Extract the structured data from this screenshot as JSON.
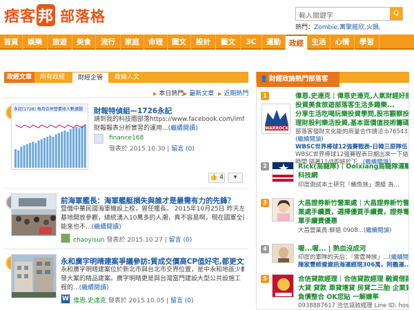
{
  "header": {
    "logo_part1": "痞客",
    "logo_badge": "邦",
    "logo_part2": "部落格",
    "search_placeholder": "輸入關鍵字",
    "search_button": "Q",
    "hot_label": "熱門：",
    "hot_keywords": "Zombie,寓聚館欣,火鍋,"
  },
  "nav": [
    {
      "label": "首頁",
      "active": false
    },
    {
      "label": "娛樂",
      "active": false
    },
    {
      "label": "旅遊",
      "active": false
    },
    {
      "label": "美食",
      "active": false
    },
    {
      "label": "流行",
      "active": false
    },
    {
      "label": "家庭",
      "active": false
    },
    {
      "label": "命理",
      "active": false
    },
    {
      "label": "圖文",
      "active": false
    },
    {
      "label": "設計",
      "active": false
    },
    {
      "label": "藝文",
      "active": false
    },
    {
      "label": "3C",
      "active": false
    },
    {
      "label": "運動",
      "active": false
    },
    {
      "label": "政經",
      "active": true
    },
    {
      "label": "生活",
      "active": false
    },
    {
      "label": "心情",
      "active": false
    },
    {
      "label": "學習",
      "active": false
    }
  ],
  "left": {
    "tabs": [
      "政經文章",
      "所有政經",
      "財經企管",
      "政論人文"
    ],
    "sort": {
      "today": "本日熱門",
      "latest": "最新文章",
      "recent": "近期熱門"
    }
  },
  "entries": [
    {
      "rank": "1",
      "title": "財報特偵組—1726永記",
      "desc1": "請到我的科技圈部落https://www.facebook.com/imfinance168 IFRS",
      "desc2": "財報報表分析實習的運用...",
      "more": "(繼續閱讀)",
      "author": "finance168",
      "posted_label": "發表於",
      "date": "2015.10.30",
      "comments": "留言 (0)",
      "likes": "4",
      "thumb_title": "永記(1726)  每月合併營業收入數據圖"
    },
    {
      "rank": "2",
      "title": "前海軍艦長：海軍艦艇損失與誰才是最需有力的先鋒？",
      "desc1": "暨僑中華民國海軍機設上校，曾任艦長。 2015年10月25日 昨天左營海軍",
      "desc2": "基地開放參觀，總統湧入10萬多的人潮，真不容易啊，現在國軍全部加",
      "desc3": "能來也不...",
      "more": "(繼續閱讀)",
      "author": "chaoyisun",
      "posted_label": "發表於",
      "date": "2015.10.27",
      "comments": "留言 (0)"
    },
    {
      "rank": "3",
      "title": "永和廣字明晴建案爭議參訪:質成交價高CP值好宅,都更文創結活園區...",
      "desc1": "永和廣字明晴建案位於新北市與台北市交界位置，是中永和地區少數新開",
      "desc2": "發大案的精品建案。廣字明晴更是與台灣當門建設大型公共設施工",
      "desc3": "程的...",
      "more": "(繼續閱讀)",
      "author": "偉恩.史達克",
      "posted_label": "發表於",
      "date": "2015.10.05",
      "comments": "留言 (0)"
    }
  ],
  "right": {
    "header": "財經政論熱門部落客",
    "items": [
      {
        "rank": "1",
        "title1": "偉恩.史達克｜偉恩史達克,人氣財經好部落",
        "title2": "投資美食旅遊部落客生活多趣樂...",
        "title3": "分享生活吃喝玩樂投資學問,股市觀察投資",
        "title4": "理財股利樂活投資,基本面價值技術籌碼分析",
        "sub1": "部落客發財文化能的商量合作請洽:b765431...",
        "sub_more": "(繼續閱讀)",
        "sub2": "WBSC世界棒球12強賽戰表-日韓三原隊伍",
        "sub3": "WBSC世界棒球12強賽程表日期出來一下結",
        "sub4": "時間 隨著11/8即將於下...",
        "sub4_more": "(繼續閱讀)"
      },
      {
        "rank": "2",
        "title1": "Rick(烏龍隊)｜Oolxiang烏龍隊運動科技",
        "title2": "科技網",
        "sub1": "印度測試本土研究「鮪魚族」潛艇 為...",
        "sub_more": ""
      },
      {
        "rank": "3",
        "title1": "大昌證券新竹營業處｜大昌證券新竹營",
        "title2": "業處手續費，選擇優質手續費，證券電子下",
        "title3": "單手續費優惠",
        "sub1": "大昌營業員:鮮姐 0908...",
        "sub_more": "(繼續閱讀)"
      },
      {
        "rank": "4",
        "title1": "喔...喔... | 熱血沒成河",
        "sub1": "印度的軍隊的天后：「雷霆神族」...",
        "sub_more": "(繼續閱讀)",
        "sub2": "陳家豐師資資訊海運經現306萬，阿義運..."
      },
      {
        "rank": "5",
        "title1": "合信貸款經理｜合信貸款經理 融資借款",
        "title2": "大貸 貸款 車貸增貸 房貸二三胎 企業貸款",
        "title3": "負債整合 OK您貼 一解嫌率",
        "sub1": "0938887617 合信貸款經理 Line ID: hosi...",
        "sub_more": "(繼續閱讀)"
      }
    ]
  },
  "colors": {
    "brand_orange": "#e8561b",
    "nav_orange": "#f49a1a",
    "link_blue": "#1a5aa7",
    "name_green": "#1a8a2c"
  }
}
